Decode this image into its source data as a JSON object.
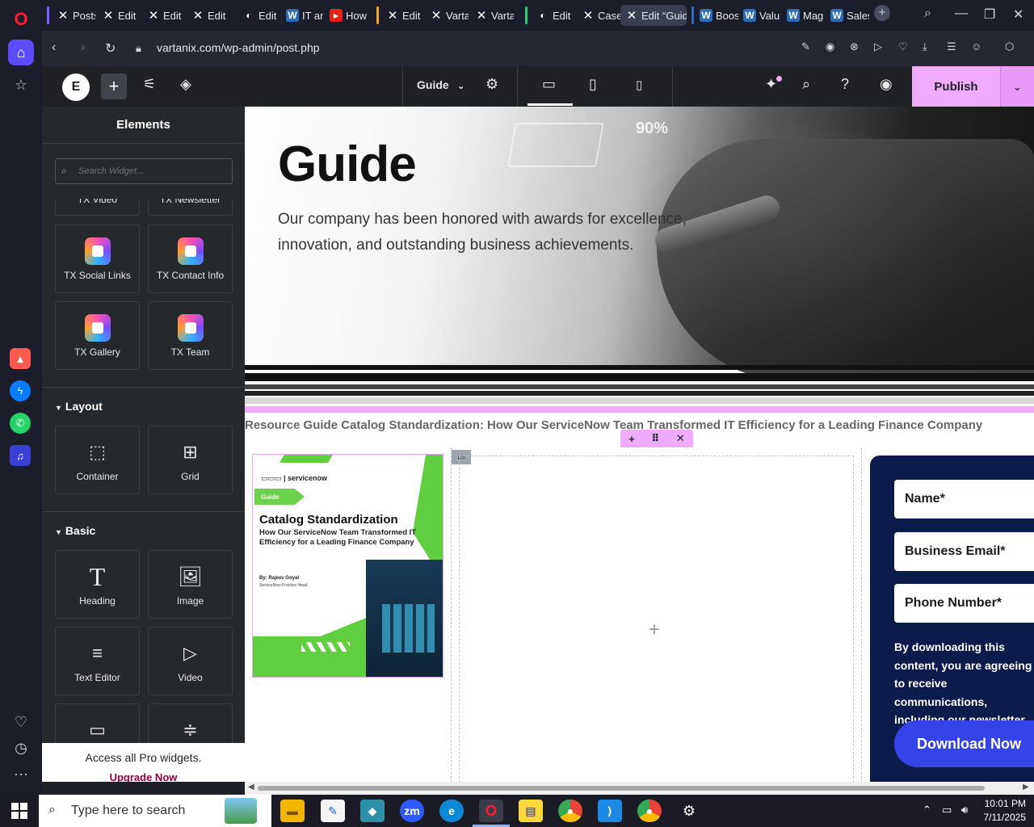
{
  "browser": {
    "tabs": [
      {
        "label": "Posts",
        "favicon": "x-logo-icon"
      },
      {
        "label": "Edit",
        "favicon": "x-logo-icon"
      },
      {
        "label": "Edit",
        "favicon": "x-logo-icon"
      },
      {
        "label": "Edit",
        "favicon": "x-logo-icon"
      },
      {
        "label": "Edit",
        "favicon": "opera-icon"
      },
      {
        "label": "IT an",
        "favicon": "wordpress-icon"
      },
      {
        "label": "How",
        "favicon": "youtube-icon"
      },
      {
        "label": "Edit",
        "favicon": "x-logo-icon"
      },
      {
        "label": "Varta",
        "favicon": "x-logo-icon"
      },
      {
        "label": "Varta",
        "favicon": "x-logo-icon"
      },
      {
        "label": "Edit",
        "favicon": "opera-icon"
      },
      {
        "label": "Case",
        "favicon": "x-logo-icon"
      },
      {
        "label": "Edit “Guid",
        "favicon": "x-logo-icon"
      },
      {
        "label": "Boos",
        "favicon": "wordpress-icon"
      },
      {
        "label": "Valu",
        "favicon": "wordpress-icon"
      },
      {
        "label": "Mag",
        "favicon": "wordpress-icon"
      },
      {
        "label": "Sales",
        "favicon": "wordpress-icon"
      }
    ],
    "url": "vartanix.com/wp-admin/post.php"
  },
  "editor": {
    "page_name": "Guide",
    "publish_label": "Publish"
  },
  "panel": {
    "title": "Elements",
    "search_placeholder": "Search Widget...",
    "partial_row": [
      "TX Video",
      "TX Newsletter"
    ],
    "tx_widgets": [
      {
        "label": "TX Social Links"
      },
      {
        "label": "TX Contact Info"
      },
      {
        "label": "TX Gallery"
      },
      {
        "label": "TX Team"
      }
    ],
    "layout_title": "Layout",
    "layout_widgets": [
      {
        "label": "Container",
        "icon": "container-icon"
      },
      {
        "label": "Grid",
        "icon": "grid-icon"
      }
    ],
    "basic_title": "Basic",
    "basic_widgets": [
      {
        "label": "Heading",
        "icon": "heading-icon"
      },
      {
        "label": "Image",
        "icon": "image-icon"
      },
      {
        "label": "Text Editor",
        "icon": "text-editor-icon"
      },
      {
        "label": "Video",
        "icon": "video-icon"
      }
    ],
    "pro_text": "Access all Pro widgets.",
    "pro_link": "Upgrade Now"
  },
  "canvas": {
    "hero_title": "Guide",
    "hero_description": "Our company has been honored with awards for excellence, innovation, and outstanding business achievements.",
    "hero_overlay_stat": "90%",
    "breadcrumb": "Resource Guide Catalog Standardization: How Our ServiceNow Team Transformed IT Efficiency for a Leading Finance Company",
    "cover": {
      "logo": "▭▭▭ | servicenow",
      "tag": "Guide",
      "title": "Catalog Standardization",
      "subtitle": "How Our ServiceNow Team Transformed IT Efficiency for a Leading Finance Company",
      "author": "By: Rajeev Goyal",
      "role": "ServiceNow Practice Head"
    },
    "form": {
      "name_placeholder": "Name*",
      "email_placeholder": "Business Email*",
      "phone_placeholder": "Phone Number*",
      "consent": "By downloading this content, you are agreeing to receive communications, including our newsletter.",
      "button": "Download Now"
    }
  },
  "taskbar": {
    "search_placeholder": "Type here to search",
    "time": "10:01 PM",
    "date": "7/11/2025"
  },
  "colors": {
    "accent_pink": "#f0abfc",
    "form_bg": "#0b1b4b",
    "cta_blue": "#3643e8",
    "cover_green": "#5fcf3f"
  }
}
